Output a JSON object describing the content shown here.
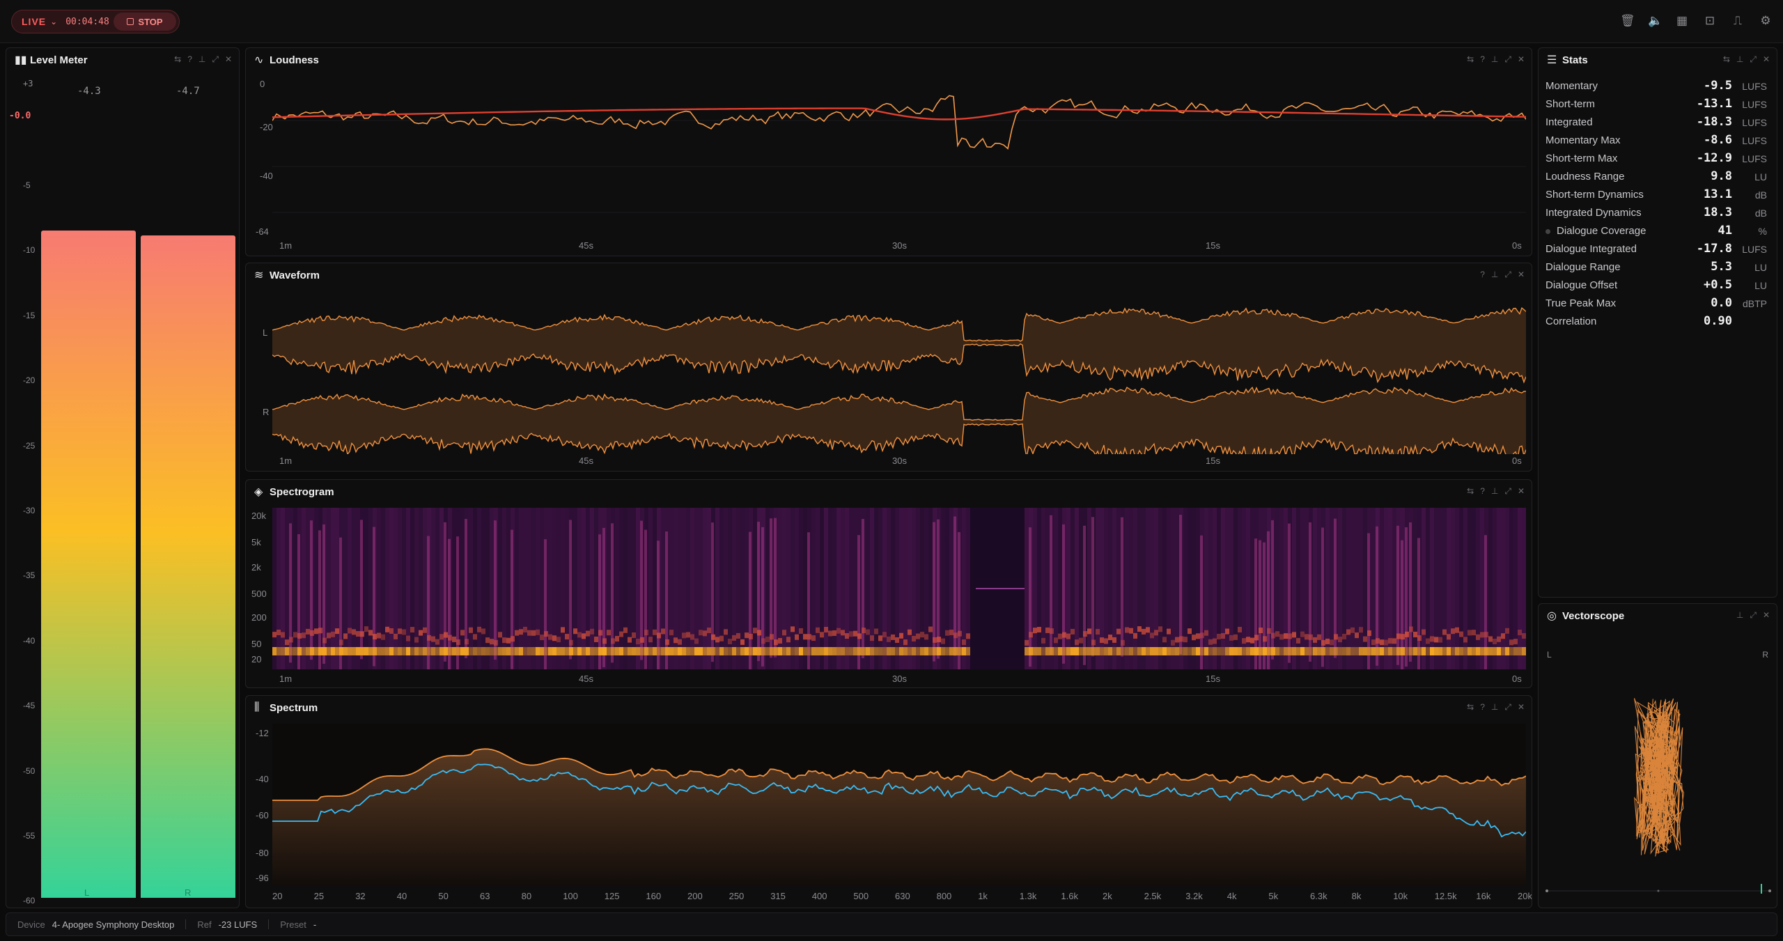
{
  "topbar": {
    "live_label": "LIVE",
    "timer": "00:04:48",
    "stop_label": "STOP",
    "icons": [
      "trash-icon",
      "speaker-icon",
      "grid-icon",
      "capture-icon",
      "bookmark-icon",
      "gear-icon"
    ]
  },
  "level_meter": {
    "title": "Level Meter",
    "peak_hold": "+3",
    "peak_value": "-0.0",
    "left_reading": "-4.3",
    "right_reading": "-4.7",
    "scale": [
      "-5",
      "-10",
      "-15",
      "-20",
      "-25",
      "-30",
      "-35",
      "-40",
      "-45",
      "-50",
      "-55",
      "-60"
    ],
    "left_level_db": -3.9,
    "right_level_db": -4.3,
    "channel_left": "L",
    "channel_right": "R",
    "colors": {
      "top": "#f77b72",
      "mid": "#fbbf24",
      "bottom": "#34d399"
    }
  },
  "loudness": {
    "title": "Loudness",
    "y_ticks": [
      "0",
      "-20",
      "-40",
      "-64"
    ],
    "x_ticks": [
      "1m",
      "45s",
      "30s",
      "15s",
      "0s"
    ]
  },
  "waveform": {
    "title": "Waveform",
    "channels": [
      "L",
      "R"
    ],
    "x_ticks": [
      "1m",
      "45s",
      "30s",
      "15s",
      "0s"
    ],
    "color": "#f0913f"
  },
  "spectrogram": {
    "title": "Spectrogram",
    "y_ticks": [
      "20k",
      "5k",
      "2k",
      "500",
      "200",
      "50",
      "20"
    ],
    "x_ticks": [
      "1m",
      "45s",
      "30s",
      "15s",
      "0s"
    ]
  },
  "spectrum": {
    "title": "Spectrum",
    "y_ticks": [
      "-12",
      "-40",
      "-60",
      "-80",
      "-96"
    ],
    "x_ticks": [
      "20",
      "25",
      "32",
      "40",
      "50",
      "63",
      "80",
      "100",
      "125",
      "160",
      "200",
      "250",
      "315",
      "400",
      "500",
      "630",
      "800",
      "1k",
      "1.3k",
      "1.6k",
      "2k",
      "2.5k",
      "3.2k",
      "4k",
      "5k",
      "6.3k",
      "8k",
      "10k",
      "12.5k",
      "16k",
      "20k"
    ],
    "colors": {
      "peak": "#f0913f",
      "avg": "#38bdf8"
    }
  },
  "stats": {
    "title": "Stats",
    "rows": [
      {
        "label": "Momentary",
        "value": "-9.5",
        "unit": "LUFS"
      },
      {
        "label": "Short-term",
        "value": "-13.1",
        "unit": "LUFS"
      },
      {
        "label": "Integrated",
        "value": "-18.3",
        "unit": "LUFS"
      },
      {
        "label": "Momentary Max",
        "value": "-8.6",
        "unit": "LUFS"
      },
      {
        "label": "Short-term Max",
        "value": "-12.9",
        "unit": "LUFS"
      },
      {
        "label": "Loudness Range",
        "value": "9.8",
        "unit": "LU"
      },
      {
        "label": "Short-term Dynamics",
        "value": "13.1",
        "unit": "dB"
      },
      {
        "label": "Integrated Dynamics",
        "value": "18.3",
        "unit": "dB"
      },
      {
        "label": "Dialogue Coverage",
        "value": "41",
        "unit": "%"
      },
      {
        "label": "Dialogue Integrated",
        "value": "-17.8",
        "unit": "LUFS"
      },
      {
        "label": "Dialogue Range",
        "value": "5.3",
        "unit": "LU"
      },
      {
        "label": "Dialogue Offset",
        "value": "+0.5",
        "unit": "LU"
      },
      {
        "label": "True Peak Max",
        "value": "0.0",
        "unit": "dBTP"
      },
      {
        "label": "Correlation",
        "value": "0.90",
        "unit": ""
      }
    ]
  },
  "vectorscope": {
    "title": "Vectorscope",
    "left": "L",
    "right": "R"
  },
  "statusbar": {
    "device_key": "Device",
    "device_value": "4- Apogee Symphony Desktop",
    "ref_key": "Ref",
    "ref_value": "-23 LUFS",
    "preset_key": "Preset",
    "preset_value": "-"
  }
}
